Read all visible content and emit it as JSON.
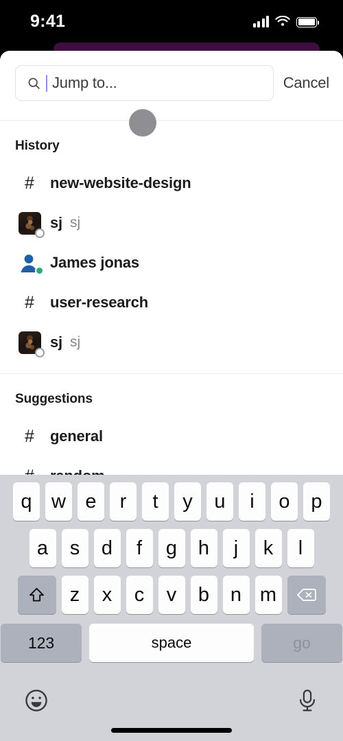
{
  "status_bar": {
    "time": "9:41",
    "cellular_icon": "signal-bars-icon",
    "wifi_icon": "wifi-icon",
    "battery_icon": "battery-icon"
  },
  "search": {
    "placeholder": "Jump to...",
    "value": "",
    "search_icon": "search-icon",
    "cancel_label": "Cancel"
  },
  "sections": [
    {
      "label": "History",
      "items": [
        {
          "type": "channel",
          "icon": "hash-icon",
          "hash": "#",
          "name": "new-website-design",
          "handle": ""
        },
        {
          "type": "person",
          "icon": "avatar-photo",
          "name": "sj",
          "handle": "sj",
          "presence": "away"
        },
        {
          "type": "person",
          "icon": "person-glyph-icon",
          "name": "James jonas",
          "handle": "",
          "presence": "active"
        },
        {
          "type": "channel",
          "icon": "hash-icon",
          "hash": "#",
          "name": "user-research",
          "handle": ""
        },
        {
          "type": "person",
          "icon": "avatar-photo",
          "name": "sj",
          "handle": "sj",
          "presence": "away"
        }
      ]
    },
    {
      "label": "Suggestions",
      "items": [
        {
          "type": "channel",
          "icon": "hash-icon",
          "hash": "#",
          "name": "general",
          "handle": ""
        },
        {
          "type": "channel",
          "icon": "hash-icon",
          "hash": "#",
          "name": "random",
          "handle": ""
        }
      ]
    }
  ],
  "keyboard": {
    "row1": [
      "q",
      "w",
      "e",
      "r",
      "t",
      "y",
      "u",
      "i",
      "o",
      "p"
    ],
    "row2": [
      "a",
      "s",
      "d",
      "f",
      "g",
      "h",
      "j",
      "k",
      "l"
    ],
    "row3": [
      "z",
      "x",
      "c",
      "v",
      "b",
      "n",
      "m"
    ],
    "shift_icon": "shift-icon",
    "backspace_icon": "backspace-icon",
    "numbers_label": "123",
    "space_label": "space",
    "go_label": "go",
    "emoji_icon": "emoji-icon",
    "dictation_icon": "microphone-icon"
  },
  "colors": {
    "brand_purple": "#3F0E40",
    "presence_active": "#2BAC76",
    "caret": "#8E8FE8",
    "keyboard_bg": "#D1D3D9"
  }
}
